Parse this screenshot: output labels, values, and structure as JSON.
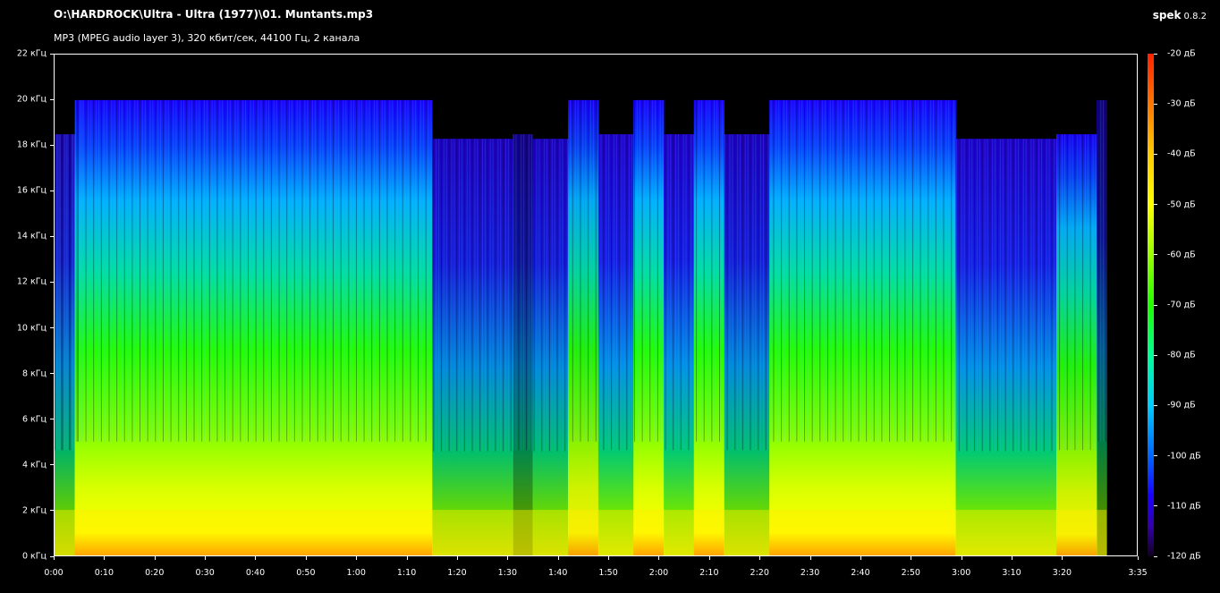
{
  "window": {
    "file_path": "O:\\HARDROCK\\Ultra - Ultra (1977)\\01. Muntants.mp3",
    "file_info": "MP3 (MPEG audio layer 3), 320 кбит/сек, 44100 Гц, 2 канала",
    "app_name": "spek",
    "app_version": "0.8.2"
  },
  "chart_data": {
    "type": "heatmap",
    "title": "O:\\HARDROCK\\Ultra - Ultra (1977)\\01. Muntants.mp3",
    "subtitle": "MP3 (MPEG audio layer 3), 320 кбит/сек, 44100 Гц, 2 канала",
    "x_range_seconds": [
      0,
      215
    ],
    "y_range_khz": [
      0,
      22
    ],
    "color_range_db": [
      -120,
      -20
    ],
    "y_ticks": [
      "0 кГц",
      "2 кГц",
      "4 кГц",
      "6 кГц",
      "8 кГц",
      "10 кГц",
      "12 кГц",
      "14 кГц",
      "16 кГц",
      "18 кГц",
      "20 кГц",
      "22 кГц"
    ],
    "x_ticks": [
      "0:00",
      "0:10",
      "0:20",
      "0:30",
      "0:40",
      "0:50",
      "1:00",
      "1:10",
      "1:20",
      "1:30",
      "1:40",
      "1:50",
      "2:00",
      "2:10",
      "2:20",
      "2:30",
      "2:40",
      "2:50",
      "3:00",
      "3:10",
      "3:20",
      "3:35"
    ],
    "db_ticks": [
      "-20 дБ",
      "-30 дБ",
      "-40 дБ",
      "-50 дБ",
      "-60 дБ",
      "-70 дБ",
      "-80 дБ",
      "-90 дБ",
      "-100 дБ",
      "-110 дБ",
      "-120 дБ"
    ],
    "colors": {
      "low": "#1a00ff",
      "mid_low": "#00ccff",
      "mid": "#22ff00",
      "mid_high": "#ffff00",
      "high": "#ff2200"
    },
    "segments": [
      {
        "start": 0,
        "end": 4,
        "ceiling_khz": 18.5,
        "level": 0.55
      },
      {
        "start": 4,
        "end": 75,
        "ceiling_khz": 20,
        "level": 0.75
      },
      {
        "start": 75,
        "end": 91,
        "ceiling_khz": 18.3,
        "level": 0.6
      },
      {
        "start": 91,
        "end": 95,
        "ceiling_khz": 18.5,
        "level": 0.35
      },
      {
        "start": 95,
        "end": 102,
        "ceiling_khz": 18.3,
        "level": 0.6
      },
      {
        "start": 102,
        "end": 108,
        "ceiling_khz": 20,
        "level": 0.7
      },
      {
        "start": 108,
        "end": 115,
        "ceiling_khz": 18.5,
        "level": 0.65
      },
      {
        "start": 115,
        "end": 121,
        "ceiling_khz": 20,
        "level": 0.75
      },
      {
        "start": 121,
        "end": 127,
        "ceiling_khz": 18.5,
        "level": 0.65
      },
      {
        "start": 127,
        "end": 133,
        "ceiling_khz": 20,
        "level": 0.75
      },
      {
        "start": 133,
        "end": 142,
        "ceiling_khz": 18.5,
        "level": 0.6
      },
      {
        "start": 142,
        "end": 179,
        "ceiling_khz": 20,
        "level": 0.78
      },
      {
        "start": 179,
        "end": 199,
        "ceiling_khz": 18.3,
        "level": 0.65
      },
      {
        "start": 199,
        "end": 207,
        "ceiling_khz": 18.5,
        "level": 0.7
      },
      {
        "start": 207,
        "end": 209,
        "ceiling_khz": 20,
        "level": 0.3
      },
      {
        "start": 209,
        "end": 215,
        "ceiling_khz": 0,
        "level": 0
      }
    ]
  }
}
